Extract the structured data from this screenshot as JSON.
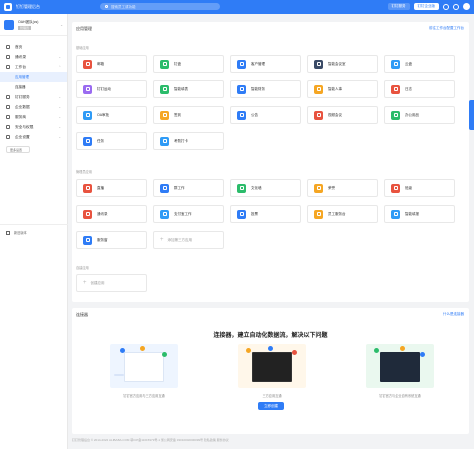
{
  "topbar": {
    "app_title": "钉钉管理后台",
    "search_placeholder": "搜索员工或功能",
    "buttons": [
      "钉钉服务",
      "钉钉企业版"
    ],
    "icons": [
      "bell-icon",
      "help-icon",
      "avatar"
    ]
  },
  "org": {
    "name": "OAH团队(cs)",
    "sub": "管理员"
  },
  "sidebar": {
    "items": [
      {
        "label": "首页",
        "icon": "home-icon",
        "chevron": false
      },
      {
        "label": "通讯录",
        "icon": "contacts-icon",
        "chevron": true
      },
      {
        "label": "工作台",
        "icon": "workbench-icon",
        "chevron": true
      }
    ],
    "subitems": [
      {
        "label": "应用管理",
        "active": true
      },
      {
        "label": "连接器",
        "active": false
      }
    ],
    "items2": [
      {
        "label": "钉钉服务",
        "icon": "service-icon"
      },
      {
        "label": "企业数据",
        "icon": "data-icon"
      },
      {
        "label": "服务商",
        "icon": "vendor-icon"
      },
      {
        "label": "安全与权限",
        "icon": "security-icon"
      },
      {
        "label": "企业设置",
        "icon": "settings-icon"
      }
    ],
    "small_button": "更多设置",
    "footer": "新旧版本"
  },
  "apps_panel": {
    "title": "应用管理",
    "link": "前往工作台配置工作台",
    "group1": "基础应用",
    "group2": "管理员应用",
    "group3": "自建应用",
    "row1": [
      {
        "label": "邮箱",
        "color": "#e8533f"
      },
      {
        "label": "钉盘",
        "color": "#2cbc6b"
      },
      {
        "label": "客户管理",
        "color": "#2f7cf6"
      },
      {
        "label": "智能会议室",
        "color": "#3a4a66"
      },
      {
        "label": "云盘",
        "color": "#2f9bf6"
      }
    ],
    "row2": [
      {
        "label": "钉钉运动",
        "color": "#9a6bf0"
      },
      {
        "label": "智能填表",
        "color": "#2cbc6b"
      },
      {
        "label": "智能财务",
        "color": "#2f7cf6"
      },
      {
        "label": "智能人事",
        "color": "#f5a623"
      },
      {
        "label": "日志",
        "color": "#e8533f"
      }
    ],
    "row3": [
      {
        "label": "OA审批",
        "color": "#2f9bf6"
      },
      {
        "label": "签到",
        "color": "#f5a623"
      },
      {
        "label": "公告",
        "color": "#2f7cf6"
      },
      {
        "label": "视频会议",
        "color": "#e8533f"
      },
      {
        "label": "办公用品",
        "color": "#2cbc6b"
      }
    ],
    "row4": [
      {
        "label": "任务",
        "color": "#2f7cf6"
      },
      {
        "label": "考勤打卡",
        "color": "#2f9bf6"
      }
    ],
    "row5": [
      {
        "label": "直播",
        "color": "#e8533f"
      },
      {
        "label": "群工作",
        "color": "#2f7cf6"
      },
      {
        "label": "文化墙",
        "color": "#2cbc6b"
      },
      {
        "label": "荣誉",
        "color": "#f5a623"
      },
      {
        "label": "班级",
        "color": "#e8533f"
      }
    ],
    "row6": [
      {
        "label": "通讯录",
        "color": "#e8533f"
      },
      {
        "label": "支付宝工作",
        "color": "#2f9bf6"
      },
      {
        "label": "投票",
        "color": "#2f7cf6"
      },
      {
        "label": "员工服务台",
        "color": "#f5a623"
      },
      {
        "label": "智能填报",
        "color": "#2f9bf6"
      }
    ],
    "row7": [
      {
        "label": "服务窗",
        "color": "#2f7cf6"
      }
    ],
    "add_label": "添加第三方应用",
    "create_label": "创建应用"
  },
  "connector_panel": {
    "title": "连接器",
    "link": "什么是连接器",
    "headline": "连接器，建立自动化数据流，解决以下问题",
    "captions": [
      "钉钉官方应用与三方应用互通",
      "三方应用互通",
      "钉钉官方与企业自有系统互通"
    ],
    "button": "立即创建"
  },
  "footer": "钉钉管理后台 © 2014-2022 ALIBABA.COM 鄂ICP备11015979号-1 浙公网安备 33010002000099号 隐私政策 服务协议",
  "colors": {
    "accent": "#2f7cf6"
  }
}
